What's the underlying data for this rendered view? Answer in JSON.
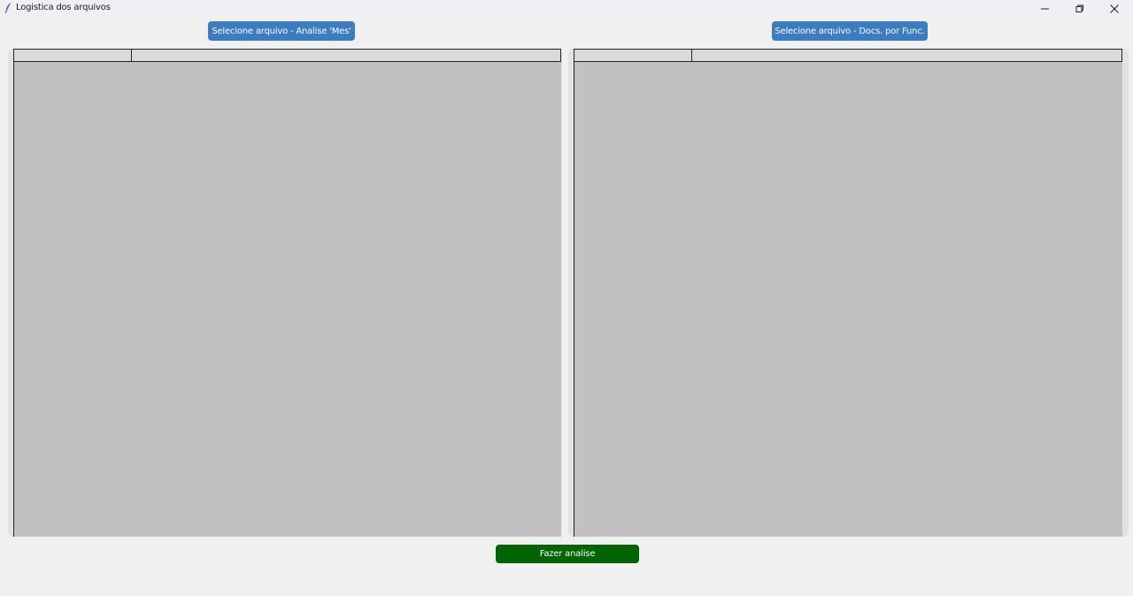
{
  "window": {
    "title": "Logistica dos arquivos",
    "app_icon": "feather-icon",
    "controls": [
      "minimize-icon",
      "restore-icon",
      "close-icon"
    ]
  },
  "buttons": {
    "select_mes": "Selecione arquivo - Analise 'Mes'",
    "select_docs": "Selecione arquivo - Docs. por Func.",
    "analyze": "Fazer analise"
  },
  "colors": {
    "select_button_bg": "#3b7dc4",
    "analyze_button_bg": "#006400",
    "table_bg": "#c1c1c1",
    "header_bg": "#d9d9d9",
    "window_bg": "#f0f0f0"
  },
  "tables": {
    "left": {
      "columns": [
        "",
        ""
      ],
      "rows": []
    },
    "right": {
      "columns": [
        "",
        ""
      ],
      "rows": []
    }
  }
}
